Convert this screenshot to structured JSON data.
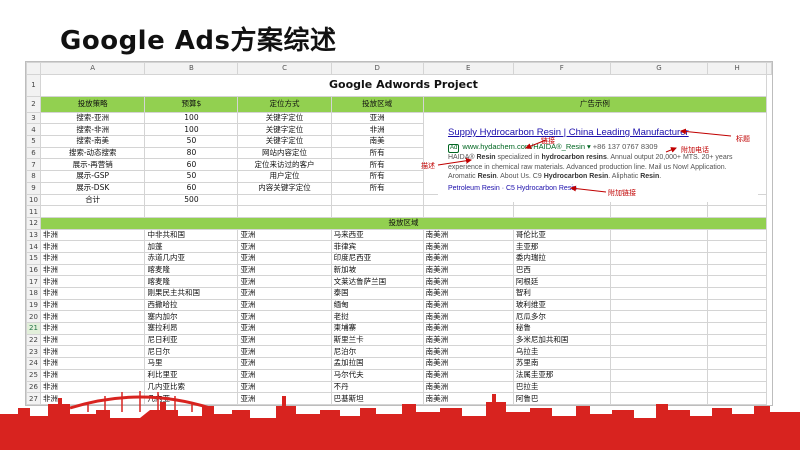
{
  "slide": {
    "title": "Google Ads方案综述"
  },
  "sheet": {
    "columns": [
      "A",
      "B",
      "C",
      "D",
      "E",
      "F",
      "G",
      "H"
    ],
    "title": "Google Adwords Project",
    "headers": [
      "投放策略",
      "预算$",
      "定位方式",
      "投放区域",
      "广告示例"
    ],
    "strategy_rows": [
      {
        "strategy": "搜索-亚洲",
        "budget": "100",
        "targeting": "关键字定位",
        "region": "亚洲"
      },
      {
        "strategy": "搜索-非洲",
        "budget": "100",
        "targeting": "关键字定位",
        "region": "非洲"
      },
      {
        "strategy": "搜索-南美",
        "budget": "50",
        "targeting": "关键字定位",
        "region": "南美"
      },
      {
        "strategy": "搜索-动态搜索",
        "budget": "80",
        "targeting": "网站内容定位",
        "region": "所有"
      },
      {
        "strategy": "展示-再营销",
        "budget": "60",
        "targeting": "定位来访过的客户",
        "region": "所有"
      },
      {
        "strategy": "展示-GSP",
        "budget": "50",
        "targeting": "用户定位",
        "region": "所有"
      },
      {
        "strategy": "展示-DSK",
        "budget": "60",
        "targeting": "内容关键字定位",
        "region": "所有"
      }
    ],
    "total_label": "合计",
    "total_value": "500",
    "region_header": "投放区域",
    "region_rows": [
      [
        "非洲",
        "中非共和国",
        "亚洲",
        "马来西亚",
        "南美洲",
        "哥伦比亚"
      ],
      [
        "非洲",
        "加蓬",
        "亚洲",
        "菲律宾",
        "南美洲",
        "圭亚那"
      ],
      [
        "非洲",
        "赤道几内亚",
        "亚洲",
        "印度尼西亚",
        "南美洲",
        "委内瑞拉"
      ],
      [
        "非洲",
        "喀麦隆",
        "亚洲",
        "新加坡",
        "南美洲",
        "巴西"
      ],
      [
        "非洲",
        "喀麦隆",
        "亚洲",
        "文莱达鲁萨兰国",
        "南美洲",
        "阿根廷"
      ],
      [
        "非洲",
        "刚果民主共和国",
        "亚洲",
        "泰国",
        "南美洲",
        "智利"
      ],
      [
        "非洲",
        "西撒哈拉",
        "亚洲",
        "缅甸",
        "南美洲",
        "玻利维亚"
      ],
      [
        "非洲",
        "塞内加尔",
        "亚洲",
        "老挝",
        "南美洲",
        "厄瓜多尔"
      ],
      [
        "非洲",
        "塞拉利昂",
        "亚洲",
        "柬埔寨",
        "南美洲",
        "秘鲁"
      ],
      [
        "非洲",
        "尼日利亚",
        "亚洲",
        "斯里兰卡",
        "南美洲",
        "多米尼加共和国"
      ],
      [
        "非洲",
        "尼日尔",
        "亚洲",
        "尼泊尔",
        "南美洲",
        "乌拉圭"
      ],
      [
        "非洲",
        "马里",
        "亚洲",
        "孟加拉国",
        "南美洲",
        "苏里南"
      ],
      [
        "非洲",
        "利比里亚",
        "亚洲",
        "马尔代夫",
        "南美洲",
        "法属圭亚那"
      ],
      [
        "非洲",
        "几内亚比索",
        "亚洲",
        "不丹",
        "南美洲",
        "巴拉圭"
      ],
      [
        "非洲",
        "几内亚",
        "亚洲",
        "巴基斯坦",
        "南美洲",
        "阿鲁巴"
      ]
    ],
    "row_numbers": [
      "1",
      "2",
      "3",
      "4",
      "5",
      "6",
      "7",
      "8",
      "9",
      "10",
      "11",
      "12",
      "13",
      "14",
      "15",
      "16",
      "17",
      "18",
      "19",
      "20",
      "21",
      "22",
      "23",
      "24",
      "25",
      "26",
      "27"
    ],
    "active_row": "21"
  },
  "ad": {
    "headline": "Supply Hydrocarbon Resin | China Leading Manufacturer",
    "badge": "Ad",
    "url": "www.hydachem.com/HAIDA®_Resin",
    "phone": "+86 137 0767 8309",
    "desc_line1_a": "HAIDA® ",
    "desc_line1_b": "Resin",
    "desc_line1_c": " specialized in ",
    "desc_line1_d": "hydrocarbon resins",
    "desc_line1_e": ". Annual output 20,000+ MTS. 20+ years",
    "desc_line2": "experience in chemical raw materials. Advanced production line. Mail us Now! Application.",
    "desc_line3_a": "Aromatic ",
    "desc_line3_b": "Resin",
    "desc_line3_c": ". About Us. C9 ",
    "desc_line3_d": "Hydrocarbon Resin",
    "desc_line3_e": ". Aliphatic ",
    "desc_line3_f": "Resin",
    "desc_line3_g": ".",
    "sitelinks": "Petroleum Resin · C5 Hydrocarbon Resin"
  },
  "annotations": {
    "title": "标题",
    "url": "链接",
    "phone": "附加电话",
    "desc": "描述",
    "sitelink": "附加链接"
  },
  "colors": {
    "header_green": "#92d050",
    "annotation_red": "#c00000",
    "skyline_red": "#d8231f"
  }
}
